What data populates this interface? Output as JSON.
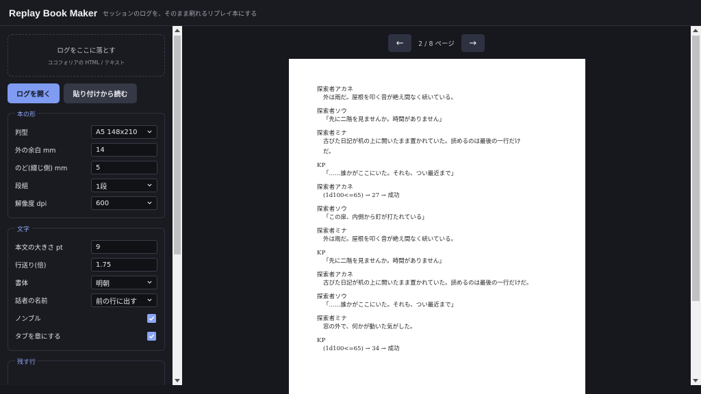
{
  "app": {
    "title": "Replay Book Maker",
    "subtitle": "セッションのログを、そのまま刷れるリプレイ本にする"
  },
  "dropzone": {
    "title": "ログをここに落とす",
    "hint": "ココフォリアの HTML / テキスト"
  },
  "actions": {
    "open_label": "ログを開く",
    "paste_label": "貼り付けから読む"
  },
  "book_shape": {
    "legend": "本の形",
    "format_label": "判型",
    "format_value": "A5 148x210",
    "outer_margin_label": "外の余白 mm",
    "outer_margin_value": "14",
    "gutter_label": "のど(綴じ側) mm",
    "gutter_value": "5",
    "columns_label": "段組",
    "columns_value": "1段",
    "dpi_label": "解像度 dpi",
    "dpi_value": "600"
  },
  "text_settings": {
    "legend": "文字",
    "size_label": "本文の大きさ pt",
    "size_value": "9",
    "leading_label": "行送り(倍)",
    "leading_value": "1.75",
    "font_label": "書体",
    "font_value": "明朝",
    "speaker_label": "話者の名前",
    "speaker_value": "前の行に出す",
    "nombre_label": "ノンブル",
    "nombre_checked": true,
    "tabs_label": "タブを章にする",
    "tabs_checked": true
  },
  "keep_lines": {
    "legend": "残す行"
  },
  "pager": {
    "prev_icon": "←",
    "next_icon": "→",
    "text": "2 / 8 ページ"
  },
  "page_entries": [
    {
      "speaker": "探索者アカネ",
      "lines": [
        "外は雨だ。屋根を叩く音が絶え間なく続いている。"
      ]
    },
    {
      "speaker": "探索者ソウ",
      "lines": [
        "「先に二階を見ませんか。時間がありません」"
      ]
    },
    {
      "speaker": "探索者ミナ",
      "lines": [
        "古びた日記が机の上に開いたまま置かれていた。読めるのは最後の一行だけ",
        "だ。"
      ]
    },
    {
      "speaker": "KP",
      "lines": [
        "「……誰かがここにいた。それも、つい最近まで」"
      ]
    },
    {
      "speaker": "探索者アカネ",
      "lines": [
        "(1d100<=65) → 27 → 成功"
      ]
    },
    {
      "speaker": "探索者ソウ",
      "lines": [
        "「この扉、内側から釘が打たれている」"
      ]
    },
    {
      "speaker": "探索者ミナ",
      "lines": [
        "外は雨だ。屋根を叩く音が絶え間なく続いている。"
      ]
    },
    {
      "speaker": "KP",
      "lines": [
        "「先に二階を見ませんか。時間がありません」"
      ]
    },
    {
      "speaker": "探索者アカネ",
      "lines": [
        "古びた日記が机の上に開いたまま置かれていた。読めるのは最後の一行だけだ。"
      ]
    },
    {
      "speaker": "探索者ソウ",
      "lines": [
        "「……誰かがここにいた。それも、つい最近まで」"
      ]
    },
    {
      "speaker": "探索者ミナ",
      "lines": [
        "窓の外で、何かが動いた気がした。"
      ]
    },
    {
      "speaker": "KP",
      "lines": [
        "(1d100<=65) → 34 → 成功"
      ]
    }
  ],
  "colors": {
    "accent": "#7f9cf2",
    "background": "#17181d",
    "panel": "#1a1b21"
  }
}
